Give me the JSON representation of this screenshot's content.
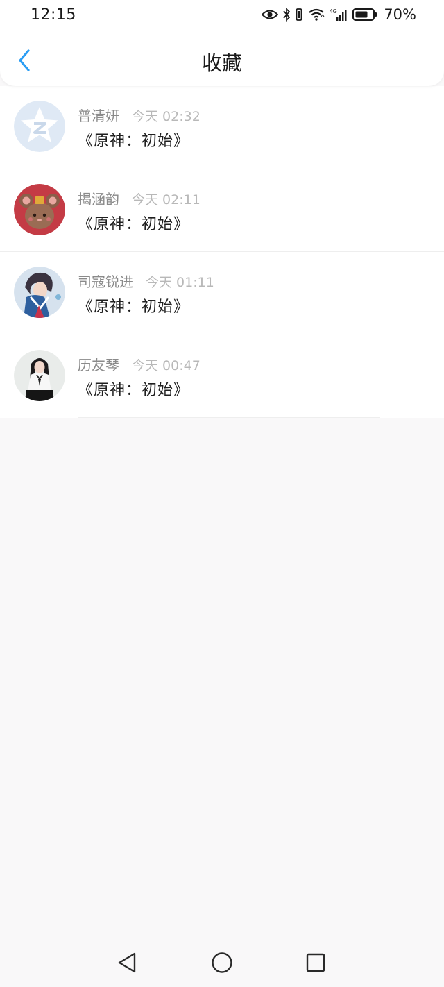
{
  "status_bar": {
    "time": "12:15",
    "battery_percent": "70%",
    "network_label": "4G",
    "icons": [
      "eye-icon",
      "bluetooth-icon",
      "vibrate-icon",
      "wifi-icon",
      "signal-icon",
      "battery-icon"
    ]
  },
  "header": {
    "title": "收藏",
    "back_icon": "chevron-left-icon"
  },
  "favorites": [
    {
      "name": "普清妍",
      "time": "今天 02:32",
      "content": "《原神：初始》",
      "avatar": "qq-logo-avatar"
    },
    {
      "name": "揭涵韵",
      "time": "今天 02:11",
      "content": "《原神：初始》",
      "avatar": "cartoon-mouse-avatar"
    },
    {
      "name": "司寇锐进",
      "time": "今天 01:11",
      "content": "《原神：初始》",
      "avatar": "anime-girl-avatar"
    },
    {
      "name": "历友琴",
      "time": "今天 00:47",
      "content": "《原神：初始》",
      "avatar": "girl-photo-avatar"
    }
  ],
  "nav_bar": {
    "icons": [
      "back-triangle-icon",
      "home-circle-icon",
      "recents-square-icon"
    ]
  },
  "colors": {
    "accent": "#2a9df4",
    "background": "#f9f8f9",
    "meta_text": "#8a8a8a",
    "timestamp_text": "#b8b8b8"
  }
}
